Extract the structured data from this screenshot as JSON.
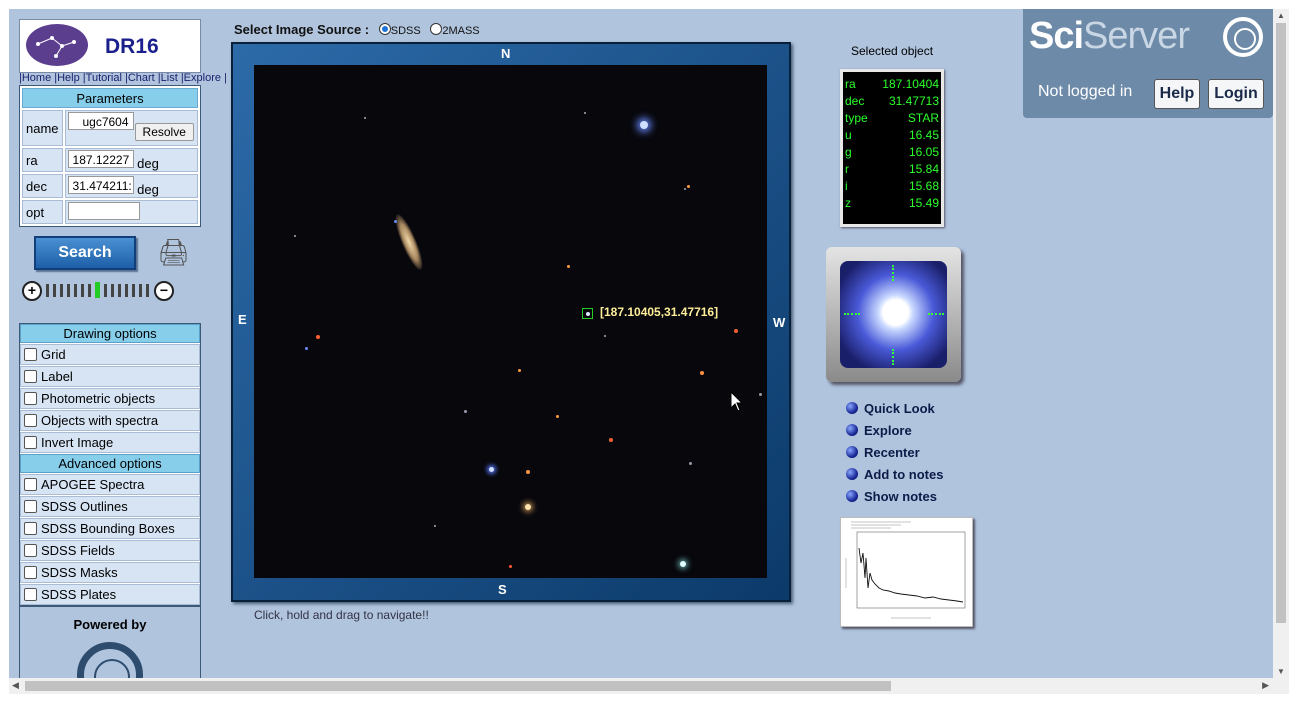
{
  "logo": {
    "title": "DR16"
  },
  "nav": "|Home |Help |Tutorial |Chart |List |Explore |",
  "params": {
    "header": "Parameters",
    "name_label": "name",
    "name_value": "ugc7604",
    "resolve_label": "Resolve",
    "ra_label": "ra",
    "ra_value": "187.12227",
    "ra_unit": "deg",
    "dec_label": "dec",
    "dec_value": "31.474211:",
    "dec_unit": "deg",
    "opt_label": "opt",
    "opt_value": ""
  },
  "search_label": "Search",
  "drawing": {
    "header": "Drawing options",
    "items": [
      "Grid",
      "Label",
      "Photometric objects",
      "Objects with spectra",
      "Invert Image"
    ],
    "advanced_header": "Advanced options",
    "advanced_items": [
      "APOGEE Spectra",
      "SDSS Outlines",
      "SDSS Bounding Boxes",
      "SDSS Fields",
      "SDSS Masks",
      "SDSS Plates"
    ],
    "powered_by": "Powered by"
  },
  "image_source": {
    "label": "Select Image Source :",
    "options": [
      "SDSS",
      "2MASS"
    ],
    "selected": "SDSS"
  },
  "compass": {
    "n": "N",
    "s": "S",
    "e": "E",
    "w": "W"
  },
  "marker_label": "[187.10405,31.47716]",
  "caption": "Click, hold and drag to navigate!!",
  "selected": {
    "title": "Selected object",
    "rows": [
      {
        "k": "ra",
        "v": "187.10404"
      },
      {
        "k": "dec",
        "v": "31.47713"
      },
      {
        "k": "type",
        "v": "STAR"
      },
      {
        "k": "u",
        "v": "16.45"
      },
      {
        "k": "g",
        "v": "16.05"
      },
      {
        "k": "r",
        "v": "15.84"
      },
      {
        "k": "i",
        "v": "15.68"
      },
      {
        "k": "z",
        "v": "15.49"
      }
    ]
  },
  "links": [
    "Quick Look",
    "Explore",
    "Recenter",
    "Add to notes",
    "Show notes"
  ],
  "sciserver": {
    "logo_a": "Sci",
    "logo_b": "Server",
    "status": "Not logged in",
    "help": "Help",
    "login": "Login"
  },
  "colors": {
    "background": "#b0c4de",
    "header": "#87ceeb",
    "accent": "#1d5fa8"
  }
}
